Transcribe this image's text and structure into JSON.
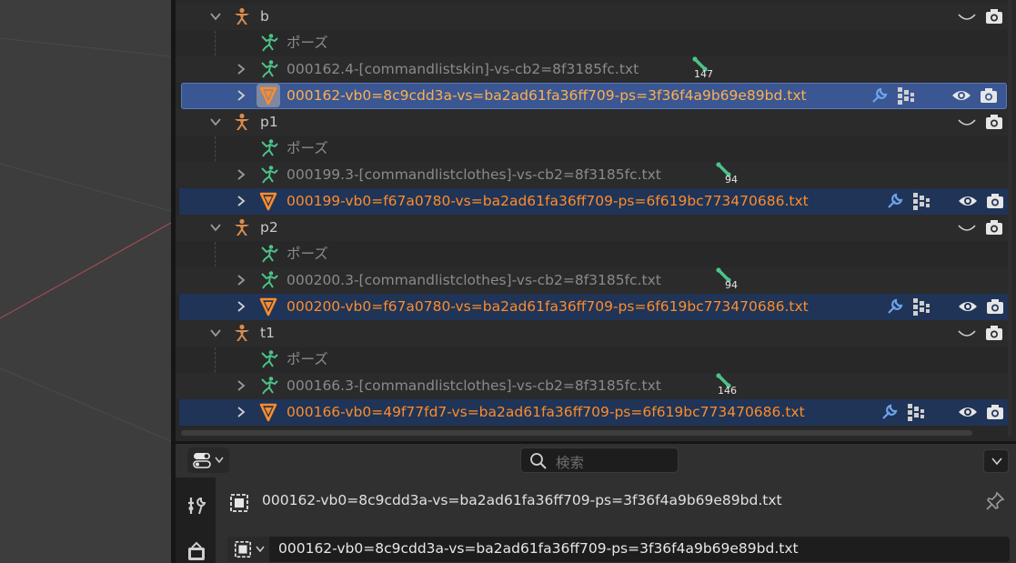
{
  "outliner": {
    "rows": [
      {
        "kind": "armature",
        "label": "b",
        "indent": 0
      },
      {
        "kind": "pose",
        "label": "ポーズ"
      },
      {
        "kind": "mesh-obj",
        "label": "000162.4-[commandlistskin]-vs-cb2=8f3185fc.txt",
        "badge": "147"
      },
      {
        "kind": "mesh",
        "label": "000162-vb0=8c9cdd3a-vs=ba2ad61fa36ff709-ps=3f36f4a9b69e89bd.txt",
        "state": "active"
      },
      {
        "kind": "armature",
        "label": "p1"
      },
      {
        "kind": "pose",
        "label": "ポーズ"
      },
      {
        "kind": "mesh-obj",
        "label": "000199.3-[commandlistclothes]-vs-cb2=8f3185fc.txt",
        "badge": "94"
      },
      {
        "kind": "mesh",
        "label": "000199-vb0=f67a0780-vs=ba2ad61fa36ff709-ps=6f619bc773470686.txt",
        "state": "selected"
      },
      {
        "kind": "armature",
        "label": "p2"
      },
      {
        "kind": "pose",
        "label": "ポーズ"
      },
      {
        "kind": "mesh-obj",
        "label": "000200.3-[commandlistclothes]-vs-cb2=8f3185fc.txt",
        "badge": "94"
      },
      {
        "kind": "mesh",
        "label": "000200-vb0=f67a0780-vs=ba2ad61fa36ff709-ps=6f619bc773470686.txt",
        "state": "selected"
      },
      {
        "kind": "armature",
        "label": "t1"
      },
      {
        "kind": "pose",
        "label": "ポーズ"
      },
      {
        "kind": "mesh-obj",
        "label": "000166.3-[commandlistclothes]-vs-cb2=8f3185fc.txt",
        "badge": "146"
      },
      {
        "kind": "mesh",
        "label": "000166-vb0=49f77fd7-vs=ba2ad61fa36ff709-ps=6f619bc773470686.txt",
        "state": "selected"
      }
    ]
  },
  "properties": {
    "search_placeholder": "検索",
    "object_title": "000162-vb0=8c9cdd3a-vs=ba2ad61fa36ff709-ps=3f36f4a9b69e89bd.txt",
    "name_field_value": "000162-vb0=8c9cdd3a-vs=ba2ad61fa36ff709-ps=3f36f4a9b69e89bd.txt"
  },
  "colors": {
    "viewport_bg": "#3d3d3d",
    "outliner_bg": "#282828",
    "armature_icon": "#d98b4e",
    "pose_icon": "#4cc38a",
    "mesh_orange": "#ff8c29",
    "active_row": "#3a5693",
    "selected_row": "#1f3457"
  }
}
